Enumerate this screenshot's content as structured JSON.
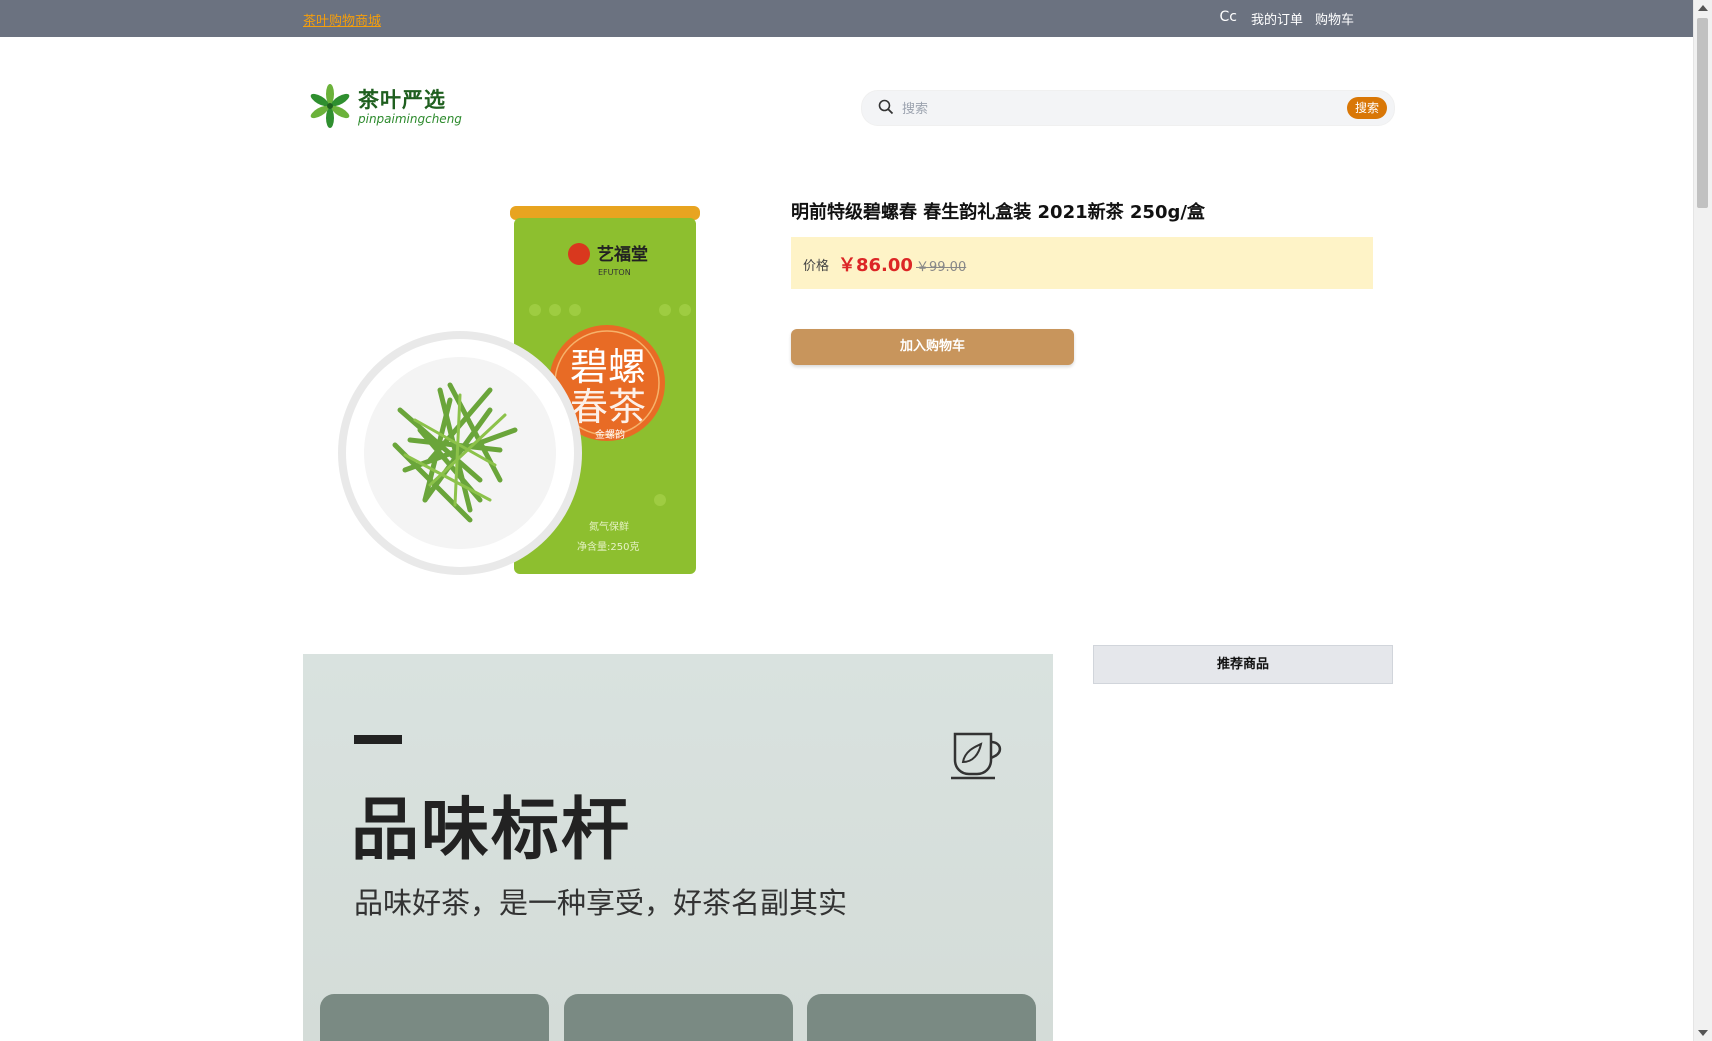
{
  "topbar": {
    "brand_link": "茶叶购物商城",
    "user": "Cc",
    "orders": "我的订单",
    "cart": "购物车"
  },
  "header": {
    "logo_name": "茶叶严选",
    "logo_sub": "pinpaimingcheng",
    "search_placeholder": "搜索",
    "search_button": "搜索"
  },
  "product": {
    "title": "明前特级碧螺春 春生韵礼盒装 2021新茶 250g/盒",
    "price_label": "价格",
    "price": "￥86.00",
    "original_price": "￥99.00",
    "add_to_cart": "加入购物车",
    "image_texts": {
      "brand": "艺福堂",
      "brand_en": "EFUTON",
      "name_line1": "碧螺",
      "name_line2": "春茶",
      "variant": "金螺韵",
      "nitrogen": "氮气保鲜",
      "net": "净含量:250克"
    }
  },
  "banner": {
    "title": "品味标杆",
    "slogan": "品味好茶，是一种享受，好茶名副其实"
  },
  "recommend": {
    "header": "推荐商品"
  },
  "colors": {
    "topbar": "#6b7280",
    "accent": "#d97706",
    "price": "#dc2626",
    "cart_button": "#c8955c"
  }
}
